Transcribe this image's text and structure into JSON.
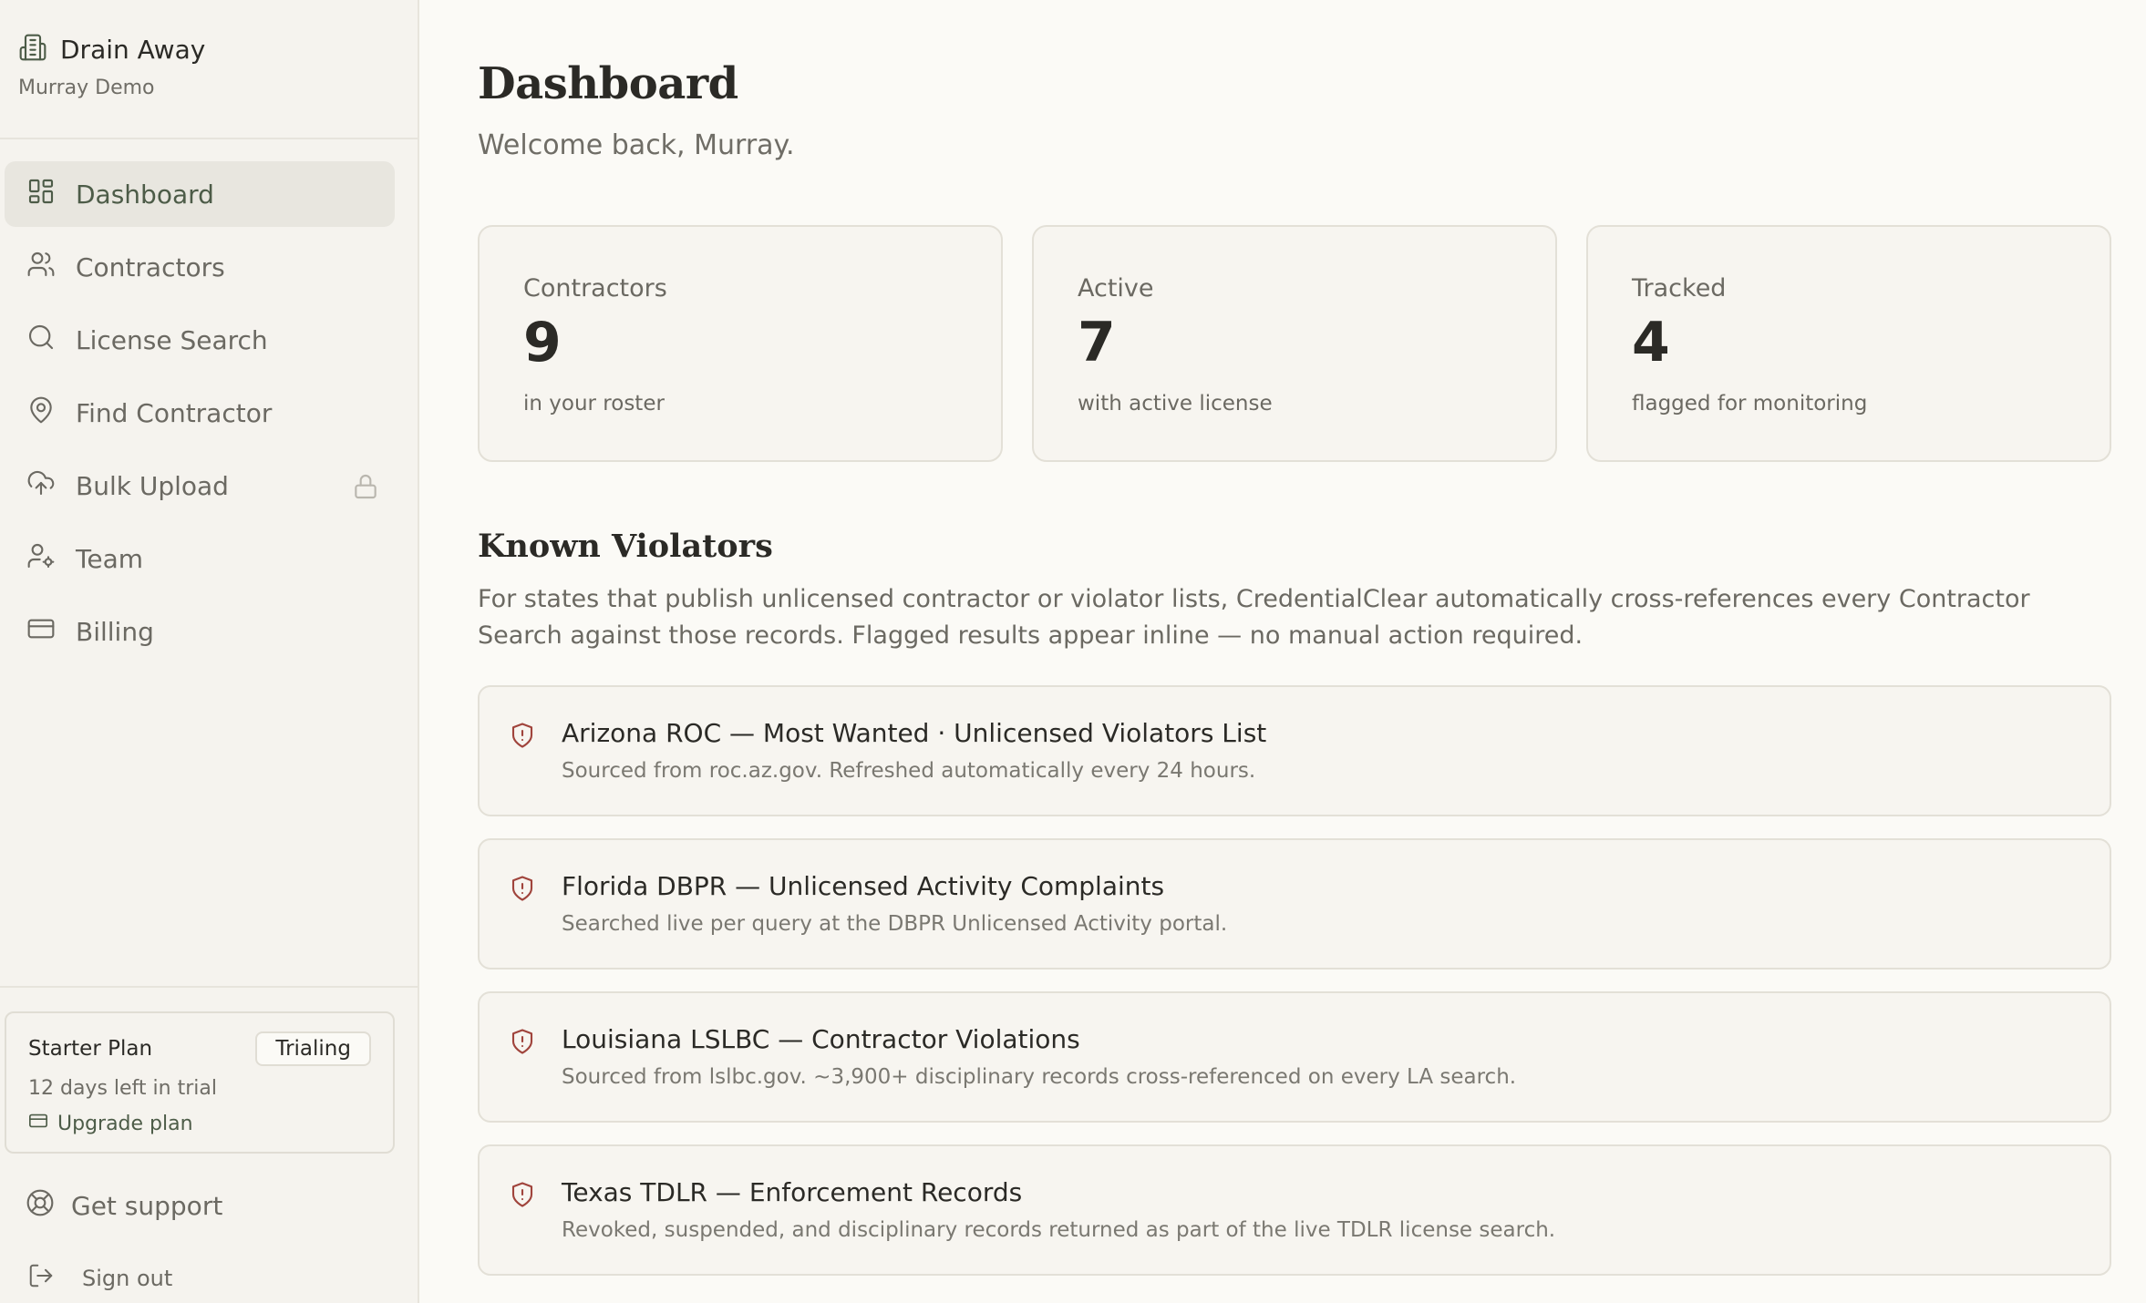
{
  "brand": {
    "title": "Drain Away",
    "subtitle": "Murray Demo"
  },
  "nav": {
    "items": [
      {
        "label": "Dashboard",
        "icon": "dashboard-grid-icon",
        "active": true
      },
      {
        "label": "Contractors",
        "icon": "users-icon"
      },
      {
        "label": "License Search",
        "icon": "search-icon"
      },
      {
        "label": "Find Contractor",
        "icon": "map-pin-icon"
      },
      {
        "label": "Bulk Upload",
        "icon": "cloud-upload-icon",
        "locked": true
      },
      {
        "label": "Team",
        "icon": "user-gear-icon"
      },
      {
        "label": "Billing",
        "icon": "credit-card-icon"
      }
    ]
  },
  "plan": {
    "name": "Starter Plan",
    "badge": "Trialing",
    "days_left": "12 days left in trial",
    "upgrade_label": "Upgrade plan"
  },
  "footer": {
    "support_label": "Get support",
    "signout_label": "Sign out"
  },
  "header": {
    "title": "Dashboard",
    "subtitle": "Welcome back, Murray."
  },
  "stats": [
    {
      "label": "Contractors",
      "value": "9",
      "note": "in your roster"
    },
    {
      "label": "Active",
      "value": "7",
      "note": "with active license"
    },
    {
      "label": "Tracked",
      "value": "4",
      "note": "flagged for monitoring"
    }
  ],
  "violators": {
    "title": "Known Violators",
    "description": "For states that publish unlicensed contractor or violator lists, CredentialClear automatically cross-references every Contractor Search against those records. Flagged results appear inline — no manual action required.",
    "items": [
      {
        "title": "Arizona ROC — Most Wanted · Unlicensed Violators List",
        "desc": "Sourced from roc.az.gov. Refreshed automatically every 24 hours."
      },
      {
        "title": "Florida DBPR — Unlicensed Activity Complaints",
        "desc": "Searched live per query at the DBPR Unlicensed Activity portal."
      },
      {
        "title": "Louisiana LSLBC — Contractor Violations",
        "desc": "Sourced from lslbc.gov. ~3,900+ disciplinary records cross-referenced on every LA search."
      },
      {
        "title": "Texas TDLR — Enforcement Records",
        "desc": "Revoked, suspended, and disciplinary records returned as part of the live TDLR license search."
      }
    ]
  },
  "colors": {
    "accent": "#4d5c48",
    "shield": "#a0443c",
    "background": "#fbfaf6",
    "sidebar": "#f5f3ee"
  }
}
